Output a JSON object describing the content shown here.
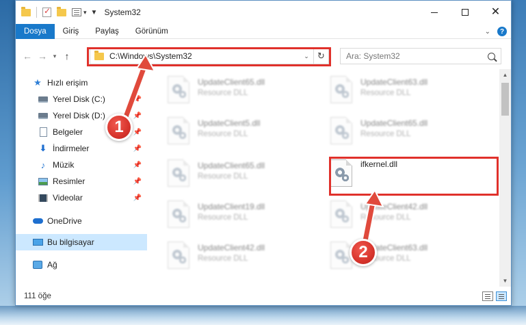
{
  "window": {
    "title": "System32",
    "controls": {
      "minimize": "minimize",
      "maximize": "maximize",
      "close": "✕"
    }
  },
  "ribbon": {
    "tabs": [
      {
        "label": "Dosya",
        "active": true
      },
      {
        "label": "Giriş"
      },
      {
        "label": "Paylaş"
      },
      {
        "label": "Görünüm"
      }
    ],
    "help_label": "?"
  },
  "address": {
    "path": "C:\\Windows\\System32",
    "search_placeholder": "Ara: System32"
  },
  "nav": {
    "items": [
      {
        "label": "Hızlı erişim",
        "icon": "star-icon"
      },
      {
        "label": "Yerel Disk (C:)",
        "icon": "drive-icon",
        "pinned": true
      },
      {
        "label": "Yerel Disk (D:)",
        "icon": "drive-icon",
        "pinned": true
      },
      {
        "label": "Belgeler",
        "icon": "document-icon",
        "pinned": true
      },
      {
        "label": "İndirmeler",
        "icon": "download-icon",
        "pinned": true
      },
      {
        "label": "Müzik",
        "icon": "music-icon",
        "pinned": true
      },
      {
        "label": "Resimler",
        "icon": "pictures-icon",
        "pinned": true
      },
      {
        "label": "Videolar",
        "icon": "video-icon",
        "pinned": true
      },
      {
        "label": "OneDrive",
        "icon": "cloud-icon"
      },
      {
        "label": "Bu bilgisayar",
        "icon": "computer-icon",
        "selected": true
      },
      {
        "label": "Ağ",
        "icon": "network-icon"
      }
    ]
  },
  "files": [
    {
      "name": "UpdateClient65.dll",
      "type": "Resource DLL",
      "blurred": true
    },
    {
      "name": "UpdateClient63.dll",
      "type": "Resource DLL",
      "blurred": true
    },
    {
      "name": "UpdateClient5.dll",
      "type": "Resource DLL",
      "blurred": true
    },
    {
      "name": "UpdateClient65.dll",
      "type": "Resource DLL",
      "blurred": true
    },
    {
      "name": "UpdateClient65.dll",
      "type": "Resource DLL",
      "blurred": true
    },
    {
      "name": "ifkernel.dll",
      "type": "",
      "blurred": false
    },
    {
      "name": "UpdateClient19.dll",
      "type": "Resource DLL",
      "blurred": true
    },
    {
      "name": "UpdateClient42.dll",
      "type": "Resource DLL",
      "blurred": true
    },
    {
      "name": "UpdateClient42.dll",
      "type": "Resource DLL",
      "blurred": true
    },
    {
      "name": "UpdateClient63.dll",
      "type": "Resource DLL",
      "blurred": true
    }
  ],
  "status": {
    "item_count": "111 öğe"
  },
  "callouts": [
    {
      "number": "1"
    },
    {
      "number": "2"
    }
  ],
  "colors": {
    "accent": "#1979ca",
    "highlight": "#e0312b",
    "selection": "#cce8ff"
  }
}
